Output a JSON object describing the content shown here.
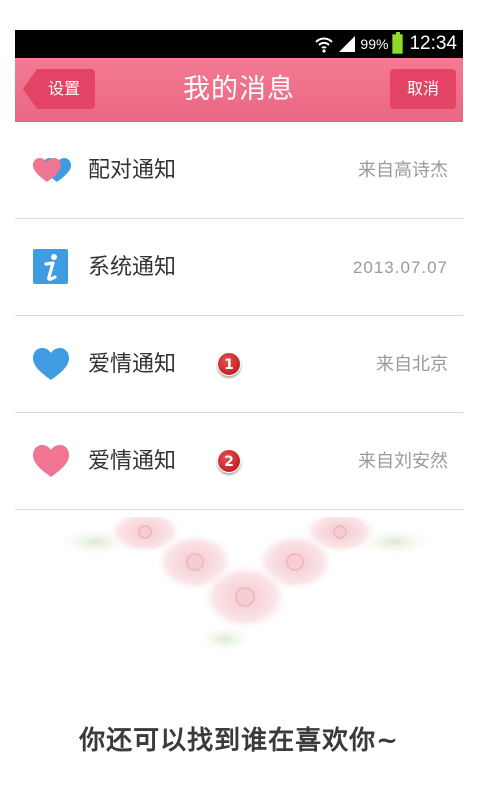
{
  "status_bar": {
    "battery_percent": "99%",
    "time": "12:34"
  },
  "header": {
    "back_label": "设置",
    "title": "我的消息",
    "cancel_label": "取消"
  },
  "messages": [
    {
      "icon": "double-heart-icon",
      "title": "配对通知",
      "meta": "来自高诗杰",
      "badge": ""
    },
    {
      "icon": "info-icon",
      "title": "系统通知",
      "meta": "2013.07.07",
      "badge": ""
    },
    {
      "icon": "blue-heart-icon",
      "title": "爱情通知",
      "meta": "来自北京",
      "badge": "1"
    },
    {
      "icon": "pink-heart-icon",
      "title": "爱情通知",
      "meta": "来自刘安然",
      "badge": "2"
    }
  ],
  "footer": {
    "slogan": "你还可以找到谁在喜欢你~"
  },
  "colors": {
    "header_pink": "#ea6783",
    "button_pink": "#e34466",
    "heart_pink": "#f07592",
    "heart_blue": "#3f9ce0",
    "badge_red": "#c21c1c",
    "status_green": "#8fdc28"
  }
}
